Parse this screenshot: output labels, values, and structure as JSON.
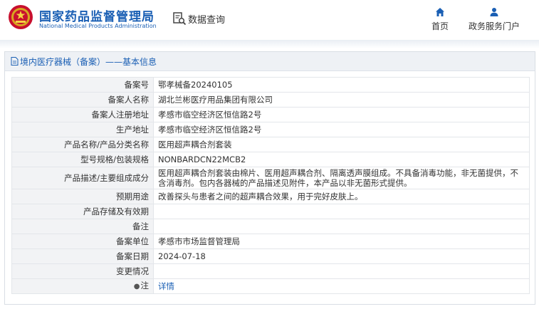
{
  "header": {
    "title_cn": "国家药品监督管理局",
    "title_en": "National Medical Products Administration",
    "search_label": "数据查询",
    "nav_home": "首页",
    "nav_portal": "政务服务门户",
    "icons": {
      "emblem": "national-emblem",
      "search": "search-document-icon",
      "home": "home-icon",
      "user": "user-icon"
    },
    "accent_color": "#1a5fb4"
  },
  "panel": {
    "breadcrumb": "境内医疗器械（备案）——基本信息",
    "rows": [
      {
        "label": "备案号",
        "value": "鄂孝械备20240105"
      },
      {
        "label": "备案人名称",
        "value": "湖北兰彬医疗用品集团有限公司"
      },
      {
        "label": "备案人注册地址",
        "value": "孝感市临空经济区恒信路2号"
      },
      {
        "label": "生产地址",
        "value": "孝感市临空经济区恒信路2号"
      },
      {
        "label": "产品名称/产品分类名称",
        "value": "医用超声耦合剂套装"
      },
      {
        "label": "型号规格/包装规格",
        "value": "NONBARDCN22MCB2"
      },
      {
        "label": "产品描述/主要组成成分",
        "value": "医用超声耦合剂套装由棉片、医用超声耦合剂、隔离透声膜组成。不具备消毒功能，非无菌提供，不含消毒剂。包内各器械的产品描述见附件，本产品以非无菌形式提供。"
      },
      {
        "label": "预期用途",
        "value": "改善探头与患者之间的超声耦合效果，用于完好皮肤上。"
      },
      {
        "label": "产品存储及有效期",
        "value": ""
      },
      {
        "label": "备注",
        "value": ""
      },
      {
        "label": "备案单位",
        "value": "孝感市市场监督管理局"
      },
      {
        "label": "备案日期",
        "value": "2024-07-18"
      },
      {
        "label": "变更情况",
        "value": ""
      },
      {
        "label": "注",
        "value": "详情"
      }
    ]
  }
}
